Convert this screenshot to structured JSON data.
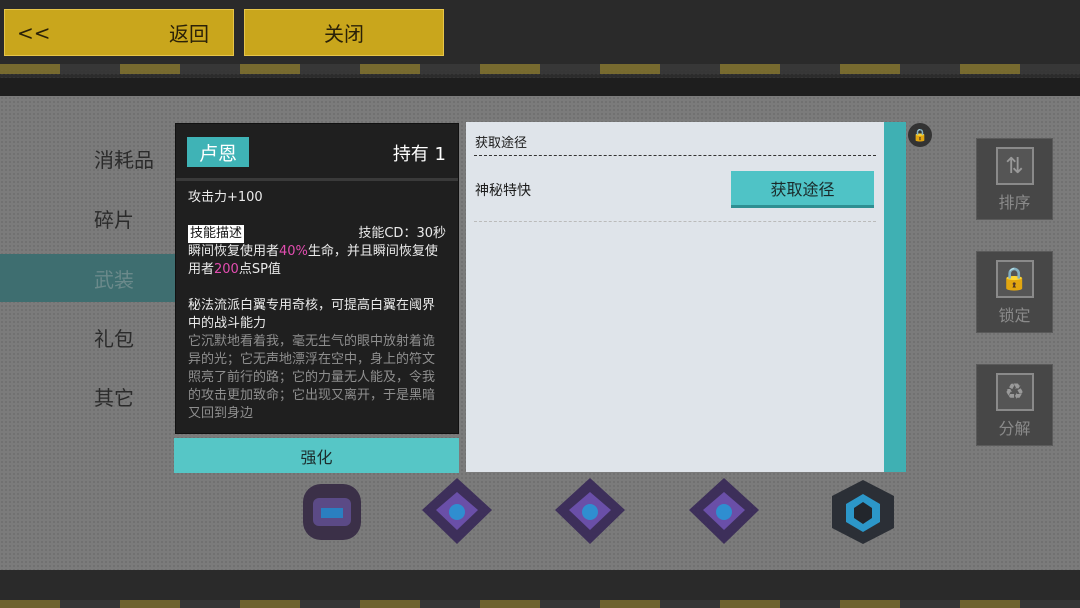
{
  "topbar": {
    "back_arrow": "<<",
    "back_label": "返回",
    "close_label": "关闭"
  },
  "categories": [
    {
      "label": "消耗品",
      "active": false
    },
    {
      "label": "碎片",
      "active": false
    },
    {
      "label": "武装",
      "active": true
    },
    {
      "label": "礼包",
      "active": false
    },
    {
      "label": "其它",
      "active": false
    }
  ],
  "side_buttons": [
    {
      "label": "排序",
      "icon": "sort-icon",
      "glyph": "⇅"
    },
    {
      "label": "锁定",
      "icon": "lock-icon",
      "glyph": "🔒"
    },
    {
      "label": "分解",
      "icon": "recycle-icon",
      "glyph": "♻"
    }
  ],
  "detail": {
    "name": "卢恩",
    "hold": "持有 1",
    "attack": "攻击力+100",
    "skill_tag": "技能描述",
    "skill_cd": "技能CD：30秒",
    "skill_desc_1": "瞬间恢复使用者",
    "skill_desc_pct": "40%",
    "skill_desc_2": "生命，并且瞬间恢复使用者",
    "skill_desc_sp": "200",
    "skill_desc_3": "点SP值",
    "core_desc": "秘法流派白翼专用奇核，可提高白翼在阈界中的战斗能力",
    "flavor": "它沉默地看着我，毫无生气的眼中放射着诡异的光；它无声地漂浮在空中，身上的符文照亮了前行的路；它的力量无人能及，令我的攻击更加致命；它出现又离开，于是黑暗又回到身边",
    "enhance_label": "强化"
  },
  "source": {
    "title": "获取途径",
    "item_name": "神秘特快",
    "button_label": "获取途径"
  },
  "colors": {
    "accent": "#3fb3b6",
    "highlight": "#e24db0",
    "topbar_button": "#c9a61c"
  }
}
